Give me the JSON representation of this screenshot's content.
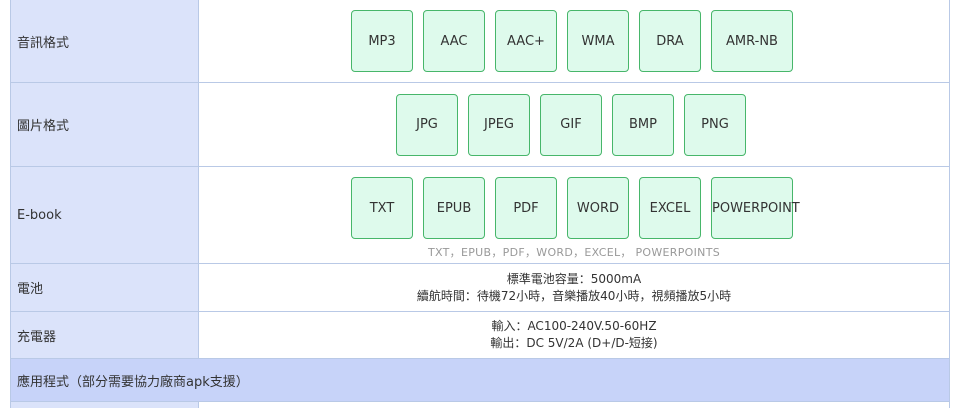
{
  "audio": {
    "label": "音訊格式",
    "formats": [
      "MP3",
      "AAC",
      "AAC+",
      "WMA",
      "DRA",
      "AMR-NB"
    ]
  },
  "image": {
    "label": "圖片格式",
    "formats": [
      "JPG",
      "JPEG",
      "GIF",
      "BMP",
      "PNG"
    ]
  },
  "ebook": {
    "label": "E-book",
    "formats": [
      "TXT",
      "EPUB",
      "PDF",
      "WORD",
      "EXCEL",
      "POWERPOINT"
    ],
    "caption": "TXT，EPUB，PDF，WORD，EXCEL， POWERPOINTS"
  },
  "battery": {
    "label": "電池",
    "line1": "標準電池容量：5000mA",
    "line2": "續航時間：待機72小時，音樂播放40小時，視頻播放5小時"
  },
  "charger": {
    "label": "充電器",
    "line1": "輸入：AC100-240V.50-60HZ",
    "line2": "輸出：DC 5V/2A (D+/D-短接)"
  },
  "apps": {
    "label": "應用程式（部分需要協力廠商apk支援）"
  }
}
